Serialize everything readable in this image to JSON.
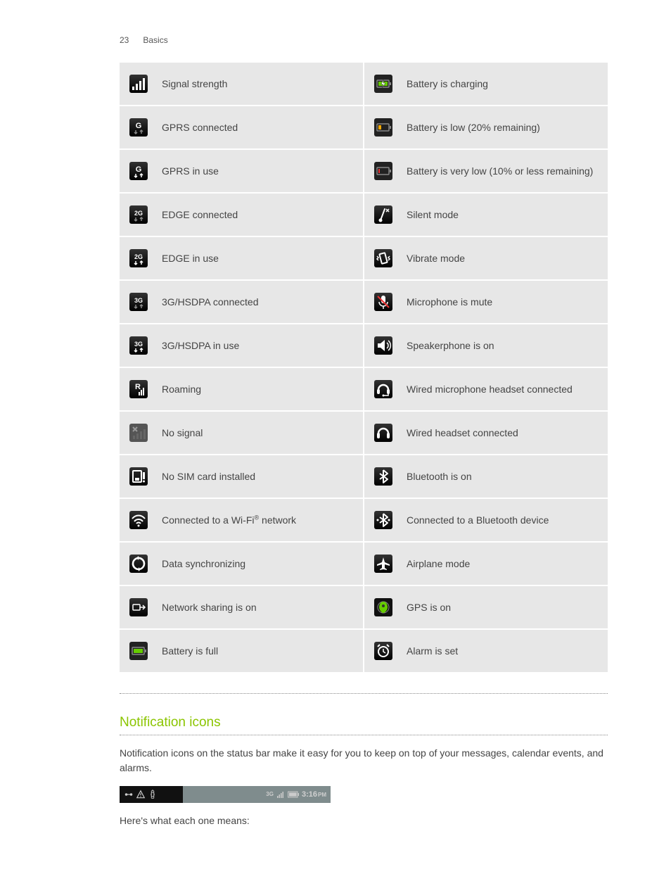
{
  "page_number": "23",
  "chapter": "Basics",
  "icons_left": [
    {
      "id": "signal-strength",
      "label": "Signal strength"
    },
    {
      "id": "gprs-connected",
      "label": "GPRS connected"
    },
    {
      "id": "gprs-in-use",
      "label": "GPRS in use"
    },
    {
      "id": "edge-connected",
      "label": "EDGE connected"
    },
    {
      "id": "edge-in-use",
      "label": "EDGE in use"
    },
    {
      "id": "3g-connected",
      "label": "3G/HSDPA connected"
    },
    {
      "id": "3g-in-use",
      "label": "3G/HSDPA in use"
    },
    {
      "id": "roaming",
      "label": "Roaming"
    },
    {
      "id": "no-signal",
      "label": "No signal"
    },
    {
      "id": "no-sim",
      "label": "No SIM card installed"
    },
    {
      "id": "wifi",
      "label_html": "Connected to a Wi-Fi<sup>®</sup> network"
    },
    {
      "id": "data-sync",
      "label": "Data synchronizing"
    },
    {
      "id": "network-sharing",
      "label": "Network sharing is on"
    },
    {
      "id": "battery-full",
      "label": "Battery is full"
    }
  ],
  "icons_right": [
    {
      "id": "battery-charging",
      "label": "Battery is charging"
    },
    {
      "id": "battery-low",
      "label": "Battery is low (20% remaining)"
    },
    {
      "id": "battery-very-low",
      "label": "Battery is very low (10% or less remaining)"
    },
    {
      "id": "silent-mode",
      "label": "Silent mode"
    },
    {
      "id": "vibrate-mode",
      "label": "Vibrate mode"
    },
    {
      "id": "mic-mute",
      "label": "Microphone is mute"
    },
    {
      "id": "speakerphone",
      "label": "Speakerphone is on"
    },
    {
      "id": "wired-mic-headset",
      "label": "Wired microphone headset connected"
    },
    {
      "id": "wired-headset",
      "label": "Wired headset connected"
    },
    {
      "id": "bluetooth-on",
      "label": "Bluetooth is on"
    },
    {
      "id": "bluetooth-connected",
      "label": "Connected to a Bluetooth device"
    },
    {
      "id": "airplane-mode",
      "label": "Airplane mode"
    },
    {
      "id": "gps-on",
      "label": "GPS is on"
    },
    {
      "id": "alarm-set",
      "label": "Alarm is set"
    }
  ],
  "section_heading": "Notification icons",
  "section_body": "Notification icons on the status bar make it easy for you to keep on top of your messages, calendar events, and alarms.",
  "statusbar_time": "3:16",
  "statusbar_ampm": "PM",
  "closing_text": "Here's what each one means:"
}
